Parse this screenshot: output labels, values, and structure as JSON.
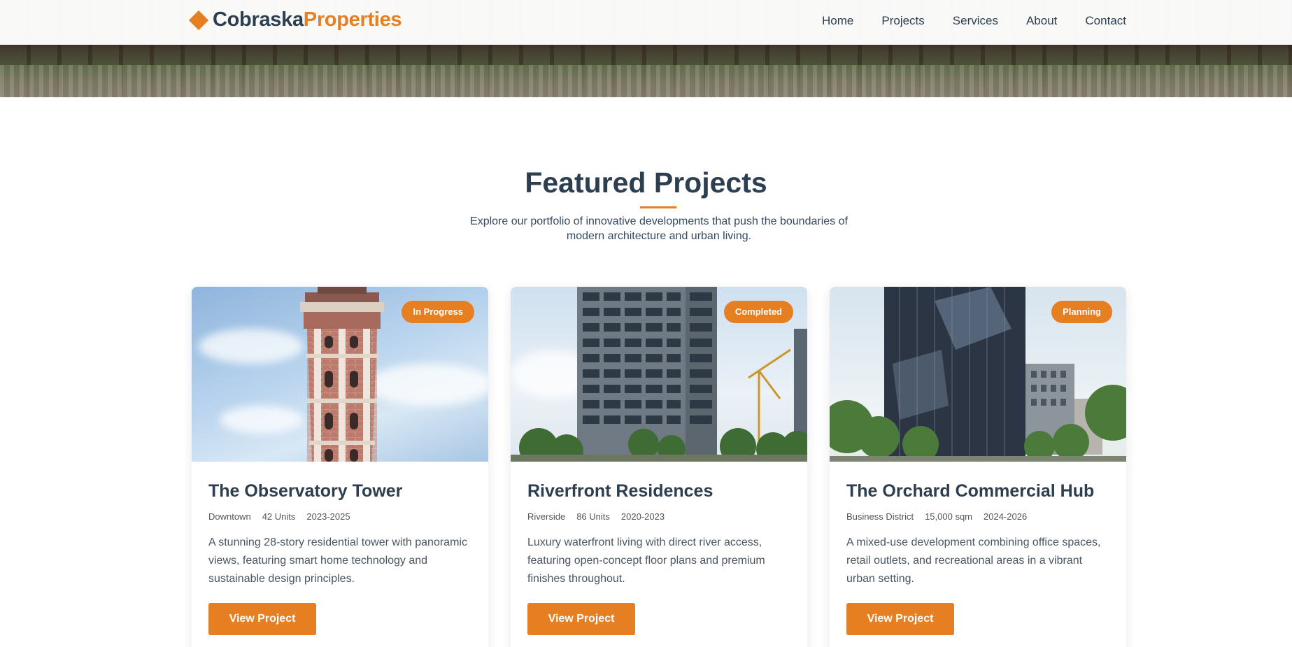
{
  "brand": {
    "name_part1": "Cobraska",
    "name_part2": "Properties",
    "accent": "#e67e22",
    "dark": "#2c3e50"
  },
  "nav": {
    "items": [
      "Home",
      "Projects",
      "Services",
      "About",
      "Contact"
    ]
  },
  "section": {
    "title": "Featured Projects",
    "subtitle": "Explore our portfolio of innovative developments that push the boundaries of modern architecture and urban living."
  },
  "projects": [
    {
      "status": "In Progress",
      "title": "The Observatory Tower",
      "location": "Downtown",
      "size": "42 Units",
      "years": "2023-2025",
      "description": "A stunning 28-story residential tower with panoramic views, featuring smart home technology and sustainable design principles.",
      "button": "View Project",
      "image_icon": "brick-tower-image"
    },
    {
      "status": "Completed",
      "title": "Riverfront Residences",
      "location": "Riverside",
      "size": "86 Units",
      "years": "2020-2023",
      "description": "Luxury waterfront living with direct river access, featuring open-concept floor plans and premium finishes throughout.",
      "button": "View Project",
      "image_icon": "apartment-building-image"
    },
    {
      "status": "Planning",
      "title": "The Orchard Commercial Hub",
      "location": "Business District",
      "size": "15,000 sqm",
      "years": "2024-2026",
      "description": "A mixed-use development combining office spaces, retail outlets, and recreational areas in a vibrant urban setting.",
      "button": "View Project",
      "image_icon": "glass-office-tower-image"
    }
  ]
}
